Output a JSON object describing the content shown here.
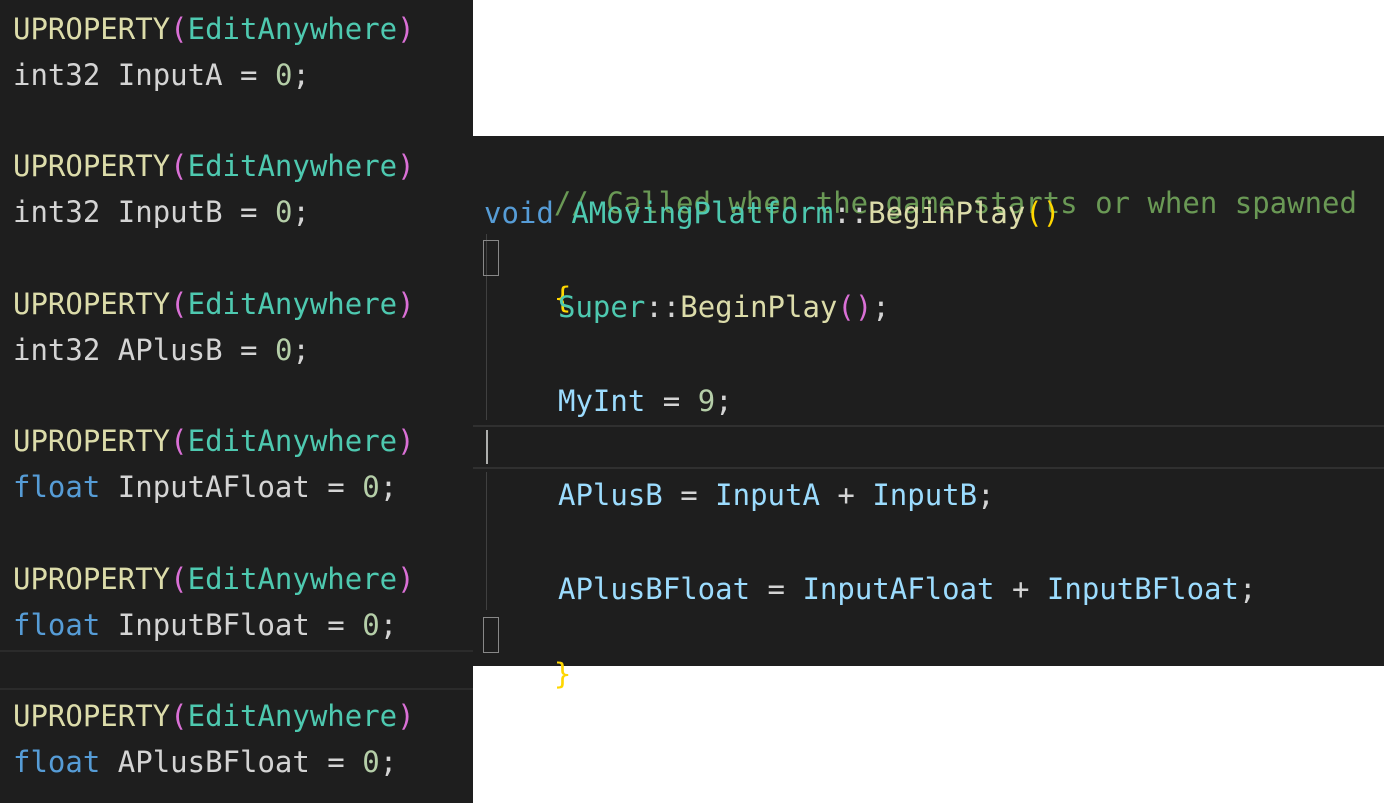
{
  "left_panel": {
    "blocks": [
      {
        "macro": "UPROPERTY",
        "spec": "EditAnywhere",
        "type": "int32",
        "name": "InputA",
        "value": "0"
      },
      {
        "macro": "UPROPERTY",
        "spec": "EditAnywhere",
        "type": "int32",
        "name": "InputB",
        "value": "0"
      },
      {
        "macro": "UPROPERTY",
        "spec": "EditAnywhere",
        "type": "int32",
        "name": "APlusB",
        "value": "0"
      },
      {
        "macro": "UPROPERTY",
        "spec": "EditAnywhere",
        "type": "float",
        "name": "InputAFloat",
        "value": "0"
      },
      {
        "macro": "UPROPERTY",
        "spec": "EditAnywhere",
        "type": "float",
        "name": "InputBFloat",
        "value": "0"
      },
      {
        "macro": "UPROPERTY",
        "spec": "EditAnywhere",
        "type": "float",
        "name": "APlusBFloat",
        "value": "0"
      }
    ]
  },
  "right_panel": {
    "comment": "// Called when the game starts or when spawned",
    "signature": {
      "return_type": "void",
      "class_name": "AMovingPlatform",
      "scope": "::",
      "function": "BeginPlay"
    },
    "open_brace": "{",
    "close_brace": "}",
    "super_call": {
      "object": "Super",
      "scope": "::",
      "function": "BeginPlay"
    },
    "assign_myint": {
      "lhs": "MyInt",
      "value": "9"
    },
    "assign_aplusb": {
      "lhs": "APlusB",
      "a": "InputA",
      "op": "+",
      "b": "InputB"
    },
    "assign_aplusbfloat": {
      "lhs": "APlusBFloat",
      "a": "InputAFloat",
      "op": "+",
      "b": "InputBFloat"
    }
  },
  "syntax_colors": {
    "background": "#1e1e1e",
    "macro": "#dcdcaa",
    "paren": "#da70d6",
    "brace": "#ffd700",
    "specifier": "#4ec9b0",
    "keyword_type": "#569cd6",
    "identifier": "#9cdcfe",
    "number": "#b5cea8",
    "comment": "#6a9955"
  }
}
